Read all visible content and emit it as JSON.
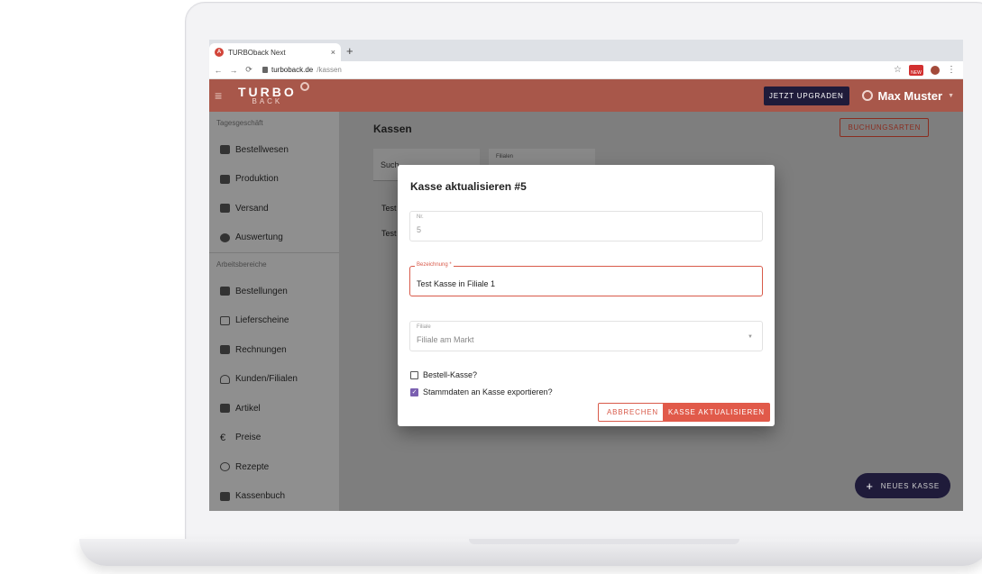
{
  "browser": {
    "tab_title": "TURBOback Next",
    "tab_close": "×",
    "new_tab": "+",
    "favicon_letter": "A",
    "url_host": "turboback.de",
    "url_path": "/kassen",
    "ext_badge": "NEW"
  },
  "header": {
    "logo_main": "TURBO",
    "logo_sub": "BACK",
    "upgrade_label": "JETZT UPGRADEN",
    "user_name": "Max Muster"
  },
  "sidebar": {
    "section1": "Tagesgeschäft",
    "items1": [
      {
        "label": "Bestellwesen",
        "icon": "cart-icon"
      },
      {
        "label": "Produktion",
        "icon": "production-icon"
      },
      {
        "label": "Versand",
        "icon": "truck-icon"
      },
      {
        "label": "Auswertung",
        "icon": "pie-chart-icon"
      }
    ],
    "section2": "Arbeitsbereiche",
    "items2": [
      {
        "label": "Bestellungen",
        "icon": "cart-icon"
      },
      {
        "label": "Lieferscheine",
        "icon": "list-icon"
      },
      {
        "label": "Rechnungen",
        "icon": "invoice-icon"
      },
      {
        "label": "Kunden/Filialen",
        "icon": "person-icon"
      },
      {
        "label": "Artikel",
        "icon": "tag-icon"
      },
      {
        "label": "Preise",
        "icon": "euro-icon"
      },
      {
        "label": "Rezepte",
        "icon": "clock-icon"
      },
      {
        "label": "Kassenbuch",
        "icon": "book-icon"
      }
    ]
  },
  "main": {
    "title": "Kassen",
    "buchungsarten_label": "BUCHUNGSARTEN",
    "search_placeholder": "Such",
    "filter_label": "Filialen",
    "rows": [
      "Test",
      "Test"
    ],
    "fab_label": "NEUES KASSE"
  },
  "dialog": {
    "title": "Kasse aktualisieren #5",
    "nr_label": "Nr.",
    "nr_value": "5",
    "bezeichnung_label": "Bezeichnung *",
    "bezeichnung_value": "Test Kasse in Filiale 1",
    "filiale_label": "Filiale",
    "filiale_value": "Filiale am Markt",
    "checkbox1_label": "Bestell-Kasse?",
    "checkbox1_checked": false,
    "checkbox2_label": "Stammdaten an Kasse exportieren?",
    "checkbox2_checked": true,
    "cancel_label": "ABBRECHEN",
    "submit_label": "KASSE AKTUALISIEREN"
  },
  "colors": {
    "brand": "#a8574a",
    "accent": "#e15a4a",
    "dark": "#1f1b3a"
  }
}
